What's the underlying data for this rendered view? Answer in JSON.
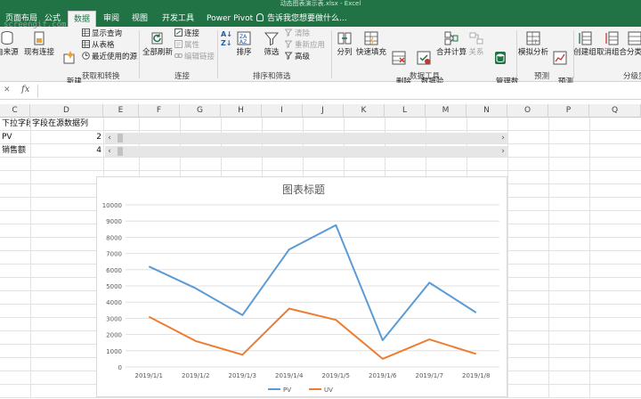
{
  "window": {
    "title": "动态图表演示表.xlsx - Excel"
  },
  "watermark": "screengif.com",
  "tabs": [
    {
      "label": "页面布局"
    },
    {
      "label": "公式"
    },
    {
      "label": "数据"
    },
    {
      "label": "审阅"
    },
    {
      "label": "视图"
    },
    {
      "label": "开发工具"
    },
    {
      "label": "Power Pivot"
    }
  ],
  "tellme": "告诉我您想要做什么...",
  "ribbon": {
    "from_source": "自来源",
    "existing_conn": "现有连接",
    "new_query": "新建\n查询",
    "show_query": "显示查询",
    "from_table": "从表格",
    "recent_sources": "最近使用的源",
    "group_get_transform": "获取和转换",
    "refresh_all": "全部刷新",
    "connections": "连接",
    "properties": "属性",
    "edit_links": "编辑链接",
    "group_connections": "连接",
    "sort": "排序",
    "filter": "筛选",
    "clear": "清除",
    "reapply": "重新应用",
    "advanced": "高级",
    "group_sort_filter": "排序和筛选",
    "text_to_columns": "分列",
    "flash_fill": "快速填充",
    "remove_duplicates": "删除\n重复项",
    "data_validation": "数据验\n证",
    "consolidate": "合并计算",
    "relationships": "关系",
    "manage_model": "管理数\n据模型",
    "group_data_tools": "数据工具",
    "what_if": "模拟分析",
    "forecast_sheet": "预测\n工作表",
    "group_forecast": "预测",
    "group_btn": "创建组",
    "ungroup": "取消组合",
    "subtotal": "分类",
    "group_outline": "分级显"
  },
  "formula_bar": {
    "cancel": "✕",
    "fx": "fx",
    "value": ""
  },
  "columns": [
    "C",
    "D",
    "E",
    "F",
    "G",
    "H",
    "I",
    "J",
    "K",
    "L",
    "M",
    "N",
    "O",
    "P",
    "Q"
  ],
  "rows": [
    {
      "c": "下拉字段",
      "d": "字段在源数据列"
    },
    {
      "c": "PV",
      "d": "2"
    },
    {
      "c": "销售额",
      "d": "4"
    }
  ],
  "chart_data": {
    "type": "line",
    "title": "图表标题",
    "categories": [
      "2019/1/1",
      "2019/1/2",
      "2019/1/3",
      "2019/1/4",
      "2019/1/5",
      "2019/1/6",
      "2019/1/7",
      "2019/1/8"
    ],
    "series": [
      {
        "name": "PV",
        "color": "#5b9bd5",
        "values": [
          6200,
          4850,
          3200,
          7250,
          8750,
          1650,
          5200,
          3350
        ]
      },
      {
        "name": "UV",
        "color": "#ed7d31",
        "values": [
          3100,
          1600,
          750,
          3600,
          2900,
          500,
          1700,
          800
        ]
      }
    ],
    "ylim": [
      0,
      10000
    ],
    "yticks": [
      0,
      1000,
      2000,
      3000,
      4000,
      5000,
      6000,
      7000,
      8000,
      9000,
      10000
    ],
    "grid": true,
    "legend": "bottom"
  }
}
